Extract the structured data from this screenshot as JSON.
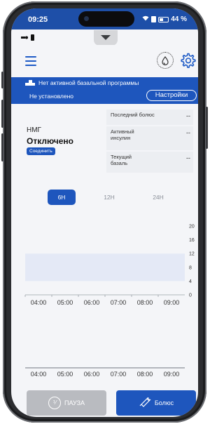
{
  "status_bar": {
    "time": "09:25",
    "battery": "44 %"
  },
  "header": {
    "menu_icon": "hamburger-menu-icon",
    "drop_icon": "insulin-drop-icon",
    "settings_icon": "gear-icon"
  },
  "banner": {
    "message": "Нет активной базальной программы",
    "sub": "Не установлено",
    "settings_label": "Настройки"
  },
  "cgm": {
    "label": "НМГ",
    "status": "Отключено",
    "connect_label": "Соединить"
  },
  "stats": [
    {
      "label": "Последний болюс",
      "value": "--"
    },
    {
      "label": "Активный инсулин",
      "value": "--"
    },
    {
      "label": "Текущий базаль",
      "value": "--"
    }
  ],
  "range_tabs": [
    {
      "label": "6H",
      "active": true
    },
    {
      "label": "12H",
      "active": false
    },
    {
      "label": "24H",
      "active": false
    }
  ],
  "chart_data": [
    {
      "type": "line",
      "x": [
        "04:00",
        "05:00",
        "06:00",
        "07:00",
        "08:00",
        "09:00"
      ],
      "series": [],
      "yticks": [
        0,
        4,
        8,
        12,
        16,
        20
      ],
      "ylim": [
        0,
        20
      ],
      "target_band": [
        4,
        12
      ],
      "target_band_color": "#e4e9f6"
    },
    {
      "type": "bar",
      "x": [
        "04:00",
        "05:00",
        "06:00",
        "07:00",
        "08:00",
        "09:00"
      ],
      "series": []
    }
  ],
  "bottom": {
    "pause_label": "ПАУЗА",
    "bolus_label": "Болюс"
  },
  "colors": {
    "primary": "#1e56bd",
    "disabled": "#b9bbc0"
  }
}
